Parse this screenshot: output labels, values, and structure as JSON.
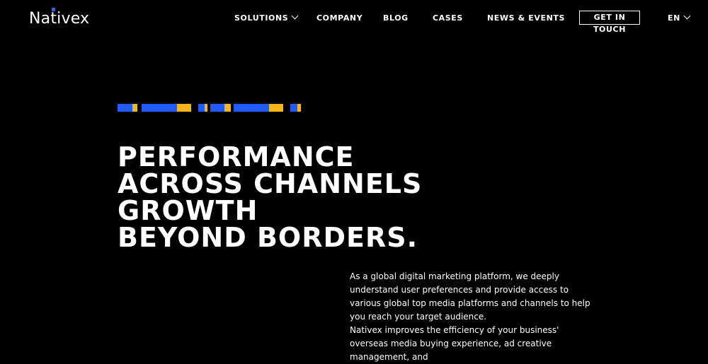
{
  "brand": {
    "name_prefix": "Na",
    "name_dot_letter": "t",
    "name_suffix": "ivex",
    "accent_color": "#2f5bff"
  },
  "nav": {
    "items": [
      {
        "label": "SOLUTIONS",
        "has_dropdown": true
      },
      {
        "label": "COMPANY"
      },
      {
        "label": "BLOG"
      },
      {
        "label": "CASES"
      },
      {
        "label": "NEWS & EVENTS"
      }
    ],
    "cta": "GET IN TOUCH",
    "language": "EN"
  },
  "hero": {
    "headline_lines": [
      "PERFORMANCE",
      "ACROSS CHANNELS",
      "GROWTH",
      "BEYOND BORDERS."
    ],
    "paragraph_1": "As a global digital marketing platform, we deeply understand user preferences and provide access to various global top media platforms and channels to help you reach your target audience.",
    "paragraph_2": "Nativex improves the efficiency of your business' overseas media buying experience, ad creative management, and"
  },
  "colors": {
    "blue": "#1f5bff",
    "yellow": "#f5b51b",
    "background": "#000000",
    "text": "#ffffff"
  }
}
